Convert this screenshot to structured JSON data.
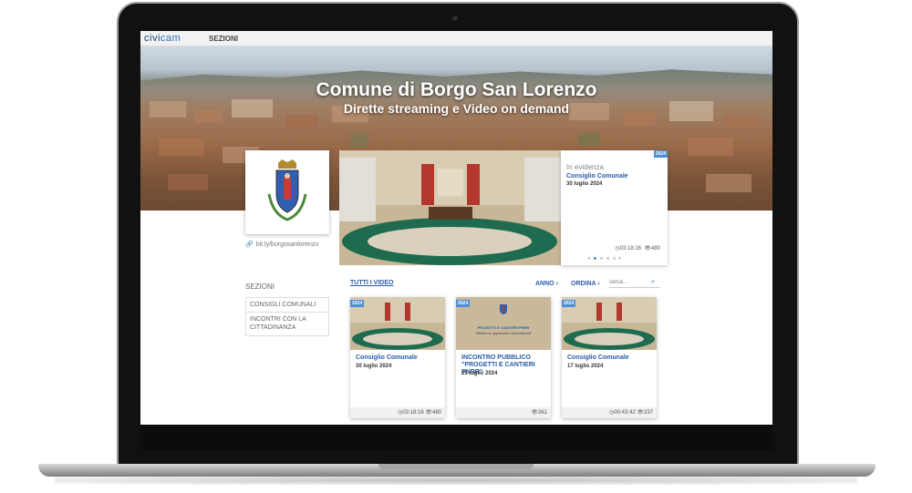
{
  "app": {
    "logo": "civicam",
    "logo_pre": "civi",
    "logo_accent": "cam",
    "nav_sezioni": "SEZIONI"
  },
  "hero": {
    "title": "Comune di Borgo San Lorenzo",
    "subtitle": "Dirette streaming e Video on demand"
  },
  "profile": {
    "link": "bit.ly/borgosanlorenzo"
  },
  "featured": {
    "badge": "2024",
    "label": "In evidenza",
    "title": "Consiglio Comunale",
    "date": "30 luglio 2024",
    "duration": "03:18:16",
    "views": "480",
    "prev": "‹",
    "next": "›"
  },
  "sidebar": {
    "heading": "SEZIONI",
    "items": [
      {
        "label": "CONSIGLI COMUNALI"
      },
      {
        "label": "INCONTRI CON LA CITTADINANZA"
      }
    ]
  },
  "filters": {
    "all_videos": "TUTTI I VIDEO",
    "year": "ANNO",
    "order": "ORDINA",
    "search_placeholder": "cerca..."
  },
  "videos": [
    {
      "badge": "2024",
      "title": "Consiglio Comunale",
      "date": "30 luglio 2024",
      "duration": "03:18:16",
      "views": "480"
    },
    {
      "badge": "2024",
      "title": "INCONTRO PUBBLICO \"PROGETTI E CANTIERI PNRR\"",
      "date": "25 luglio 2024",
      "views": "361",
      "thumb_text_1": "PROGETTI E CANTIERI PNRR",
      "thumb_text_2": "Riflettori su opportunità e finanziamenti"
    },
    {
      "badge": "2024",
      "title": "Consiglio Comunale",
      "date": "17 luglio 2024",
      "duration": "00:43:42",
      "views": "337"
    }
  ],
  "colors": {
    "accent": "#2a5ca8",
    "badge": "#4f8fd6",
    "council_table": "#1f6b4f"
  },
  "icons": {
    "clock": "clock-icon",
    "eye": "eye-icon",
    "search": "search-icon",
    "link": "link-icon",
    "chevron": "chevron-right-icon"
  }
}
